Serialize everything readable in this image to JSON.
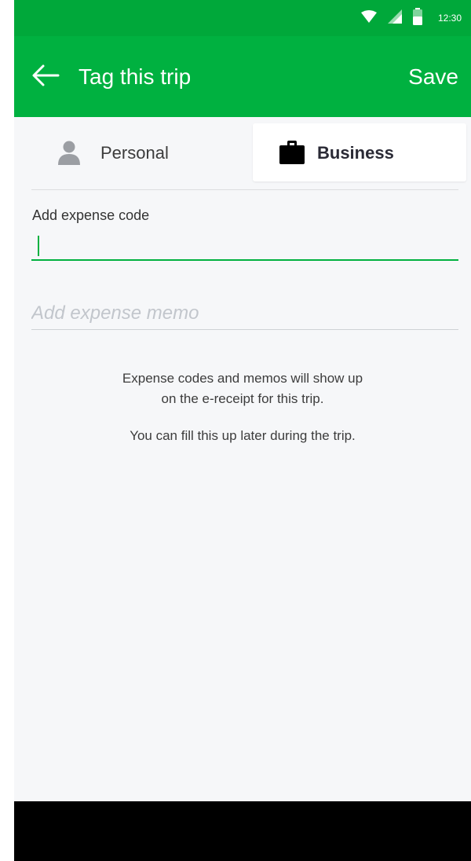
{
  "status_bar": {
    "time": "12:30",
    "icons": [
      "wifi-icon",
      "signal-icon",
      "battery-icon"
    ]
  },
  "app_bar": {
    "back_icon": "arrow-left-icon",
    "title": "Tag this trip",
    "save_label": "Save"
  },
  "trip_type": {
    "options": [
      {
        "label": "Personal",
        "icon": "person-icon",
        "selected": false
      },
      {
        "label": "Business",
        "icon": "briefcase-icon",
        "selected": true
      }
    ]
  },
  "expense_code": {
    "label": "Add expense code",
    "value": ""
  },
  "expense_memo": {
    "placeholder": "Add expense memo",
    "value": ""
  },
  "info": {
    "line1": "Expense codes and memos will show up",
    "line2": "on the e-receipt for this trip.",
    "line3": "You can fill this up later during the trip."
  },
  "colors": {
    "brand_green": "#00b140",
    "status_green": "#00a83a",
    "background": "#f6f7f9"
  }
}
